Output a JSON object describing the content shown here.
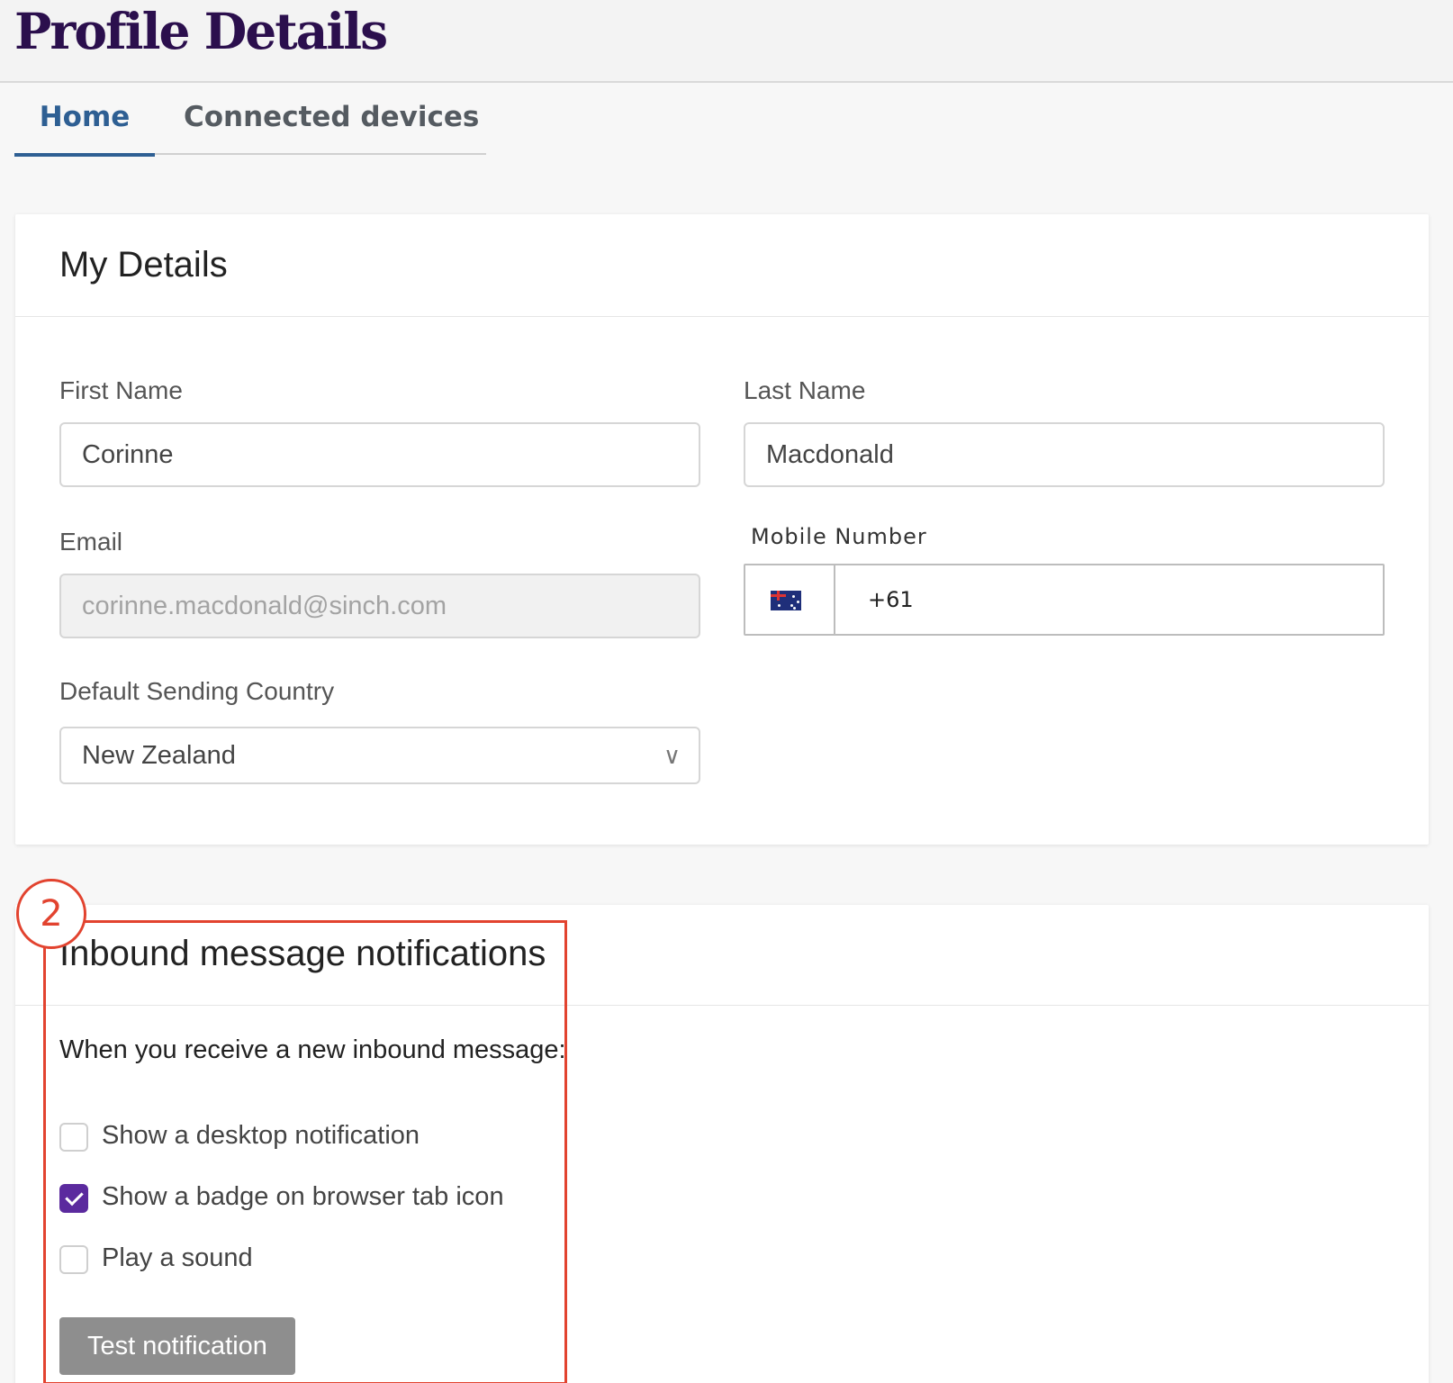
{
  "header": {
    "title": "Profile Details"
  },
  "tabs": [
    {
      "label": "Home",
      "active": true
    },
    {
      "label": "Connected devices",
      "active": false
    }
  ],
  "my_details": {
    "title": "My Details",
    "first_name": {
      "label": "First Name",
      "value": "Corinne"
    },
    "last_name": {
      "label": "Last Name",
      "value": "Macdonald"
    },
    "email": {
      "label": "Email",
      "value": "corinne.macdonald@sinch.com",
      "disabled": true
    },
    "mobile": {
      "label": "Mobile Number",
      "country_flag": "australia-flag-icon",
      "value": "+61"
    },
    "default_country": {
      "label": "Default Sending Country",
      "value": "New Zealand"
    }
  },
  "notifications": {
    "title": "Inbound message notifications",
    "lead": "When you receive a new inbound message:",
    "options": [
      {
        "label": "Show a desktop notification",
        "checked": false
      },
      {
        "label": "Show a badge on browser tab icon",
        "checked": true
      },
      {
        "label": "Play a sound",
        "checked": false
      }
    ],
    "test_button": "Test notification"
  },
  "annotation": {
    "number": "2",
    "color": "#e2432f"
  },
  "colors": {
    "title": "#2b0f4d",
    "tab_active": "#2e5f93",
    "checkbox_checked": "#5b2a9e",
    "button_disabled": "#8e8e8e"
  }
}
